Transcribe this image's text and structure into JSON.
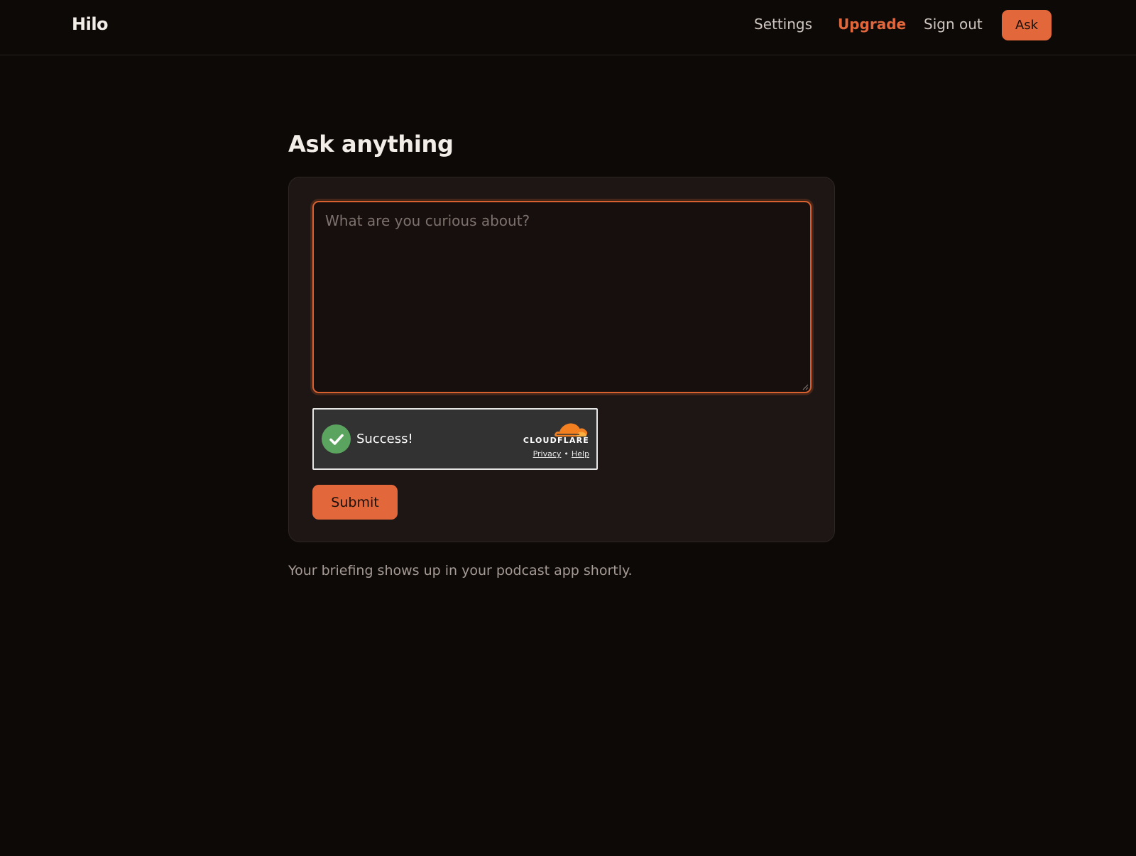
{
  "header": {
    "logo": "Hilo",
    "nav": {
      "settings": "Settings",
      "upgrade": "Upgrade",
      "sign_out": "Sign out"
    },
    "ask_button": "Ask"
  },
  "main": {
    "title": "Ask anything",
    "question_input": {
      "value": "",
      "placeholder": "What are you curious about?"
    },
    "captcha": {
      "status": "Success!",
      "brand": "CLOUDFLARE",
      "privacy_link": "Privacy",
      "separator": "•",
      "help_link": "Help"
    },
    "submit_button": "Submit",
    "footnote": "Your briefing shows up in your podcast app shortly."
  },
  "colors": {
    "accent": "#e2683c",
    "background": "#0d0907",
    "card": "#1d1614",
    "success": "#5aa45f",
    "cloudflare_orange": "#f38020"
  }
}
